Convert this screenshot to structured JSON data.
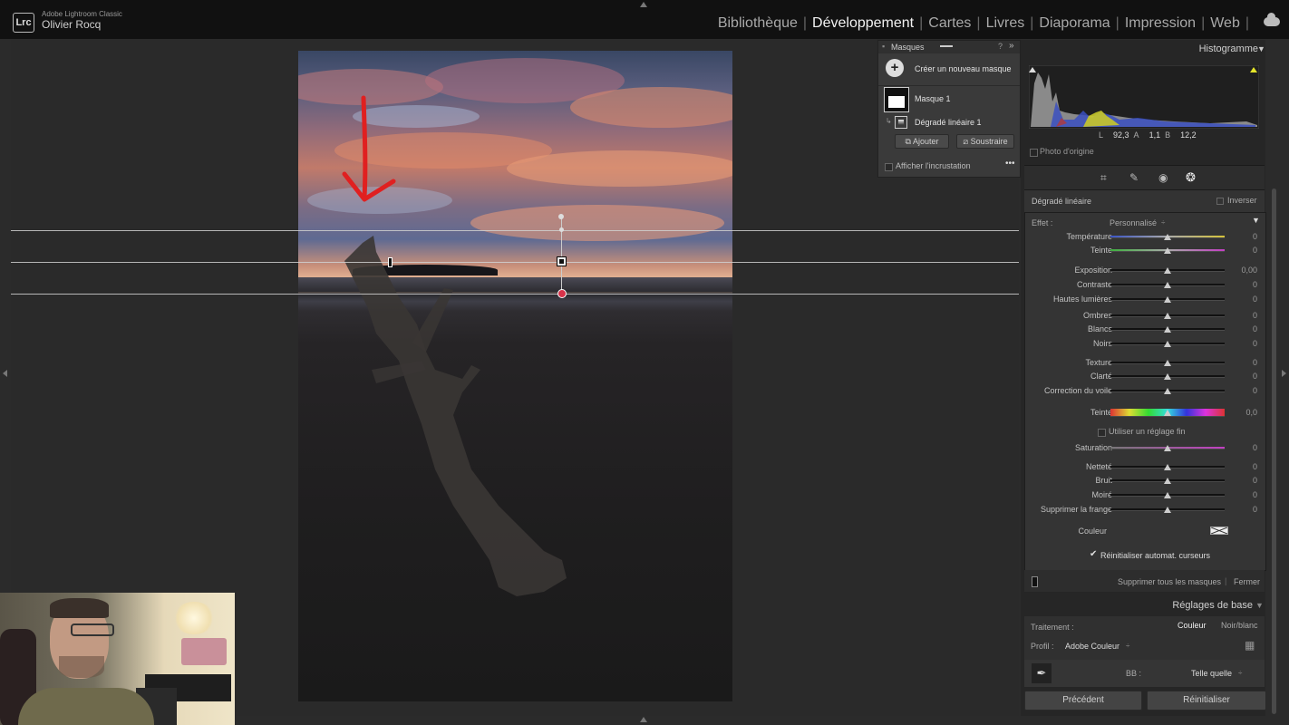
{
  "app": {
    "name": "Adobe Lightroom Classic",
    "user": "Olivier Rocq",
    "logo": "Lrc"
  },
  "modules": [
    "Bibliothèque",
    "Développement",
    "Cartes",
    "Livres",
    "Diaporama",
    "Impression",
    "Web"
  ],
  "active_module": "Développement",
  "masks_panel": {
    "title": "Masques",
    "create_label": "Créer un nouveau masque",
    "mask_name": "Masque 1",
    "component_name": "Dégradé linéaire 1",
    "add_label": "Ajouter",
    "subtract_label": "Soustraire",
    "overlay_label": "Afficher l'incrustation"
  },
  "histogram": {
    "title": "Histogramme",
    "readout": {
      "L_label": "L",
      "L": "92,3",
      "A_label": "A",
      "A": "1,1",
      "B_label": "B",
      "B": "12,2"
    },
    "original_photo_label": "Photo d'origine"
  },
  "mask_adjust": {
    "tool_title": "Dégradé linéaire",
    "invert_label": "Inverser",
    "effect_label": "Effet :",
    "effect_value": "Personnalisé",
    "sliders": [
      {
        "label": "Température",
        "value": "0",
        "pos": 0.5
      },
      {
        "label": "Teinte",
        "value": "0",
        "pos": 0.5
      },
      {
        "label": "Exposition",
        "value": "0,00",
        "pos": 0.5
      },
      {
        "label": "Contraste",
        "value": "0",
        "pos": 0.5
      },
      {
        "label": "Hautes lumières",
        "value": "0",
        "pos": 0.5
      },
      {
        "label": "Ombres",
        "value": "0",
        "pos": 0.5
      },
      {
        "label": "Blancs",
        "value": "0",
        "pos": 0.5
      },
      {
        "label": "Noirs",
        "value": "0",
        "pos": 0.5
      },
      {
        "label": "Texture",
        "value": "0",
        "pos": 0.5
      },
      {
        "label": "Clarté",
        "value": "0",
        "pos": 0.5
      },
      {
        "label": "Correction du voile",
        "value": "0",
        "pos": 0.5
      },
      {
        "label": "Teinte",
        "value": "0,0",
        "pos": 0.5
      },
      {
        "label": "Saturation",
        "value": "0",
        "pos": 0.5
      },
      {
        "label": "Netteté",
        "value": "0",
        "pos": 0.5
      },
      {
        "label": "Bruit",
        "value": "0",
        "pos": 0.5
      },
      {
        "label": "Moiré",
        "value": "0",
        "pos": 0.5
      },
      {
        "label": "Supprimer la frange",
        "value": "0",
        "pos": 0.5
      }
    ],
    "fine_adjust_label": "Utiliser un réglage fin",
    "color_label": "Couleur",
    "auto_reset_label": "Réinitialiser automat. curseurs",
    "delete_all_label": "Supprimer tous les masques",
    "close_label": "Fermer"
  },
  "basic": {
    "title": "Réglages de base",
    "treatment_label": "Traitement :",
    "color_option": "Couleur",
    "bw_option": "Noir/blanc",
    "profile_label": "Profil :",
    "profile_value": "Adobe Couleur",
    "wb_label": "BB :",
    "wb_value": "Telle quelle"
  },
  "footer": {
    "previous_label": "Précédent",
    "reset_label": "Réinitialiser"
  },
  "colors": {
    "annotation_arrow": "#e02020",
    "gradient_pin": "#d8334a"
  }
}
